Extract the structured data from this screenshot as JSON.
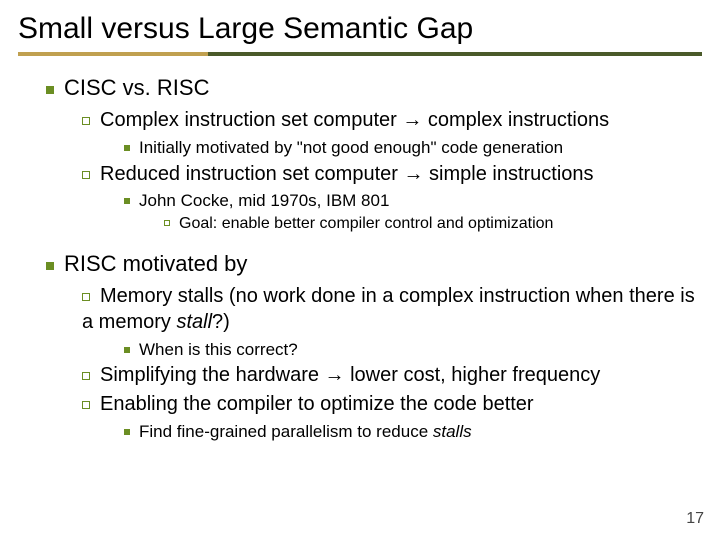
{
  "title": "Small versus Large Semantic Gap",
  "sec1": {
    "heading": "CISC vs. RISC",
    "a": {
      "line": "Complex instruction set computer → complex instructions",
      "sub": "Initially motivated by \"not good enough\" code generation"
    },
    "b": {
      "line": "Reduced instruction set computer → simple instructions",
      "sub": "John Cocke, mid 1970s, IBM 801",
      "subsub": "Goal: enable better compiler control and optimization"
    }
  },
  "sec2": {
    "heading": "RISC motivated by",
    "a": {
      "line_pre": "Memory stalls (no work done in a complex instruction when there is a memory ",
      "line_it": "stall",
      "line_post": "?)",
      "sub": "When is this correct?"
    },
    "b": "Simplifying the hardware → lower cost, higher frequency",
    "c": {
      "line": "Enabling the compiler to optimize the code better",
      "sub_pre": "Find fine-grained parallelism to reduce ",
      "sub_it": "stalls"
    }
  },
  "page_number": "17"
}
